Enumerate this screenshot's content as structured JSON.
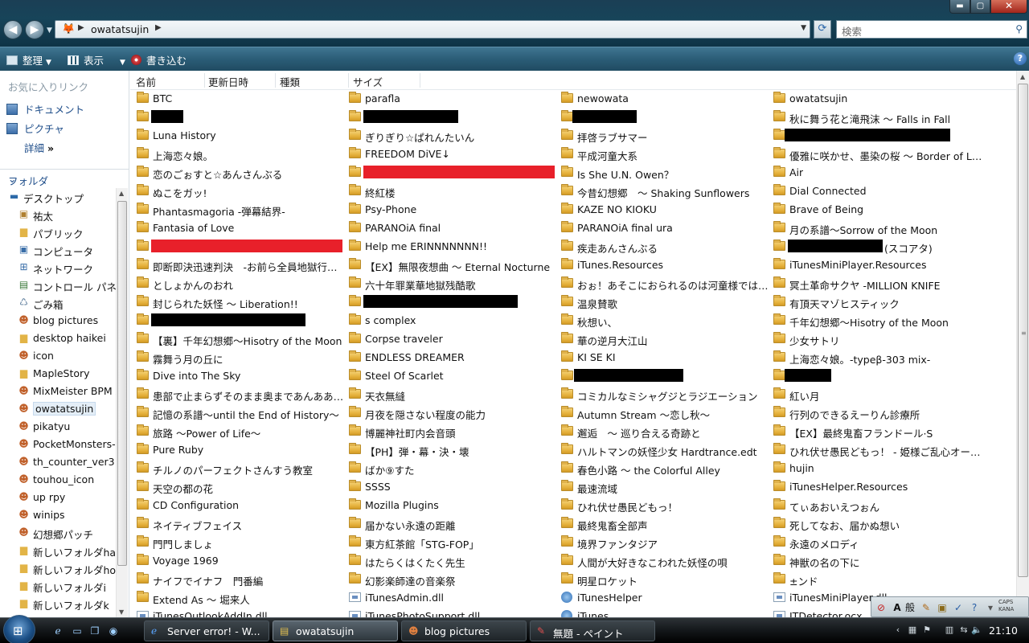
{
  "window": {
    "address": "owatatsujin",
    "search_placeholder": "検索",
    "min_label": "▬",
    "max_label": "▢",
    "close_label": "✕"
  },
  "toolbar": {
    "organize": "整理",
    "views": "表示",
    "burn": "書き込む",
    "help": "?"
  },
  "nav": {
    "favorites_title": "お気に入りリンク",
    "favorites": [
      {
        "label": "ドキュメント"
      },
      {
        "label": "ピクチャ"
      },
      {
        "label": "詳細"
      }
    ],
    "folders_title": "フォルダ",
    "tree": [
      {
        "label": "デスクトップ",
        "icon": "desktop-icon",
        "level": 0
      },
      {
        "label": "祐太",
        "icon": "user-folder-icon",
        "level": 1
      },
      {
        "label": "パブリック",
        "icon": "folder-icon",
        "level": 1
      },
      {
        "label": "コンピュータ",
        "icon": "computer-icon",
        "level": 1
      },
      {
        "label": "ネットワーク",
        "icon": "network-icon",
        "level": 1
      },
      {
        "label": "コントロール パネ",
        "icon": "control-panel-icon",
        "level": 1
      },
      {
        "label": "ごみ箱",
        "icon": "recycle-bin-icon",
        "level": 1
      },
      {
        "label": "blog pictures",
        "icon": "character-folder-icon",
        "level": 1
      },
      {
        "label": "desktop haikei",
        "icon": "folder-icon",
        "level": 1
      },
      {
        "label": "icon",
        "icon": "character-folder-icon",
        "level": 1
      },
      {
        "label": "MapleStory",
        "icon": "folder-icon",
        "level": 1
      },
      {
        "label": "MixMeister BPM A",
        "icon": "character-folder-icon",
        "level": 1
      },
      {
        "label": "owatatsujin",
        "icon": "character-folder-icon",
        "level": 1,
        "selected": true
      },
      {
        "label": "pikatyu",
        "icon": "character-folder-icon",
        "level": 1
      },
      {
        "label": "PocketMonsters-F",
        "icon": "character-folder-icon",
        "level": 1
      },
      {
        "label": "th_counter_ver3",
        "icon": "character-folder-icon",
        "level": 1
      },
      {
        "label": "touhou_icon",
        "icon": "character-folder-icon",
        "level": 1
      },
      {
        "label": "up rpy",
        "icon": "character-folder-icon",
        "level": 1
      },
      {
        "label": "winips",
        "icon": "character-folder-icon",
        "level": 1
      },
      {
        "label": "幻想郷パッチ",
        "icon": "character-folder-icon",
        "level": 1
      },
      {
        "label": "新しいフォルダha",
        "icon": "folder-icon",
        "level": 1
      },
      {
        "label": "新しいフォルダho",
        "icon": "folder-icon",
        "level": 1
      },
      {
        "label": "新しいフォルダi",
        "icon": "folder-icon",
        "level": 1
      },
      {
        "label": "新しいフォルダk",
        "icon": "folder-icon",
        "level": 1
      }
    ]
  },
  "columns": [
    "名前",
    "更新日時",
    "種類",
    "サイズ"
  ],
  "files": {
    "col1": [
      {
        "name": "BTC",
        "type": "folder"
      },
      {
        "name": "",
        "type": "folder",
        "redacted": "black-short"
      },
      {
        "name": "Luna History",
        "type": "folder"
      },
      {
        "name": "上海恋々娘。",
        "type": "folder"
      },
      {
        "name": "恋のごぉすと☆あんさんぶる",
        "type": "folder"
      },
      {
        "name": "ぬこをガッ!",
        "type": "folder"
      },
      {
        "name": "Phantasmagoria -弾幕結界-",
        "type": "folder"
      },
      {
        "name": "Fantasia of Love",
        "type": "folder"
      },
      {
        "name": "",
        "type": "folder",
        "redacted": "red-long"
      },
      {
        "name": "即断即決迅速判決　-お前ら全員地獄行き…",
        "type": "folder"
      },
      {
        "name": "としょかんのおれ",
        "type": "folder"
      },
      {
        "name": "封じられた妖怪 ～ Liberation!!",
        "type": "folder"
      },
      {
        "name": "",
        "type": "folder",
        "redacted": "black-long"
      },
      {
        "name": "【裏】千年幻想郷～Hisotry of the Moon",
        "type": "folder"
      },
      {
        "name": "霧舞う月の丘に",
        "type": "folder"
      },
      {
        "name": "Dive into The Sky",
        "type": "folder"
      },
      {
        "name": "患部で止まらずそのまま奥まであんああ…",
        "type": "folder"
      },
      {
        "name": "記憶の系譜～until the End of History～",
        "type": "folder"
      },
      {
        "name": "旅路 ～Power of Life～",
        "type": "folder"
      },
      {
        "name": "Pure Ruby",
        "type": "folder"
      },
      {
        "name": "チルノのパーフェクトさんすう教室",
        "type": "folder"
      },
      {
        "name": "天空の都の花",
        "type": "folder"
      },
      {
        "name": "CD Configuration",
        "type": "folder"
      },
      {
        "name": "ネイティブフェイス",
        "type": "folder"
      },
      {
        "name": "門門しましょ",
        "type": "folder"
      },
      {
        "name": "Voyage 1969",
        "type": "folder"
      },
      {
        "name": "ナイフでイナフ　門番編",
        "type": "folder"
      },
      {
        "name": "Extend As ～ 堀来人",
        "type": "folder"
      },
      {
        "name": "iTunesOutlookAddIn.dll",
        "type": "dll"
      }
    ],
    "col2": [
      {
        "name": "parafla",
        "type": "folder"
      },
      {
        "name": "",
        "type": "folder",
        "redacted": "black-mid"
      },
      {
        "name": "ぎりぎり☆ぱれんたいん",
        "type": "folder"
      },
      {
        "name": "FREEDOM DiVE↓",
        "type": "folder"
      },
      {
        "name": "",
        "type": "folder",
        "redacted": "red-long"
      },
      {
        "name": "終紅楼",
        "type": "folder"
      },
      {
        "name": "Psy-Phone",
        "type": "folder"
      },
      {
        "name": "PARANOiA final",
        "type": "folder"
      },
      {
        "name": "Help me ERINNNNNNN!!",
        "type": "folder"
      },
      {
        "name": "【EX】無限夜想曲 ～ Eternal Nocturne",
        "type": "folder"
      },
      {
        "name": "六十年罪業華地獄残酷歌",
        "type": "folder"
      },
      {
        "name": "",
        "type": "folder",
        "redacted": "black-long"
      },
      {
        "name": "s complex",
        "type": "folder"
      },
      {
        "name": "Corpse traveler",
        "type": "folder"
      },
      {
        "name": "ENDLESS DREAMER",
        "type": "folder"
      },
      {
        "name": "Steel Of Scarlet",
        "type": "folder"
      },
      {
        "name": "天衣無縫",
        "type": "folder"
      },
      {
        "name": "月夜を隠さない程度の能力",
        "type": "folder"
      },
      {
        "name": "博麗神社町内会音頭",
        "type": "folder"
      },
      {
        "name": "【PH】弾・幕・決・壊",
        "type": "folder"
      },
      {
        "name": "ばか⑨すた",
        "type": "folder"
      },
      {
        "name": "SSSS",
        "type": "folder"
      },
      {
        "name": "Mozilla Plugins",
        "type": "folder"
      },
      {
        "name": "届かない永遠の距離",
        "type": "folder"
      },
      {
        "name": "東方紅茶館「STG-FOP」",
        "type": "folder"
      },
      {
        "name": "はたらくはくたく先生",
        "type": "folder"
      },
      {
        "name": "幻影楽師達の音楽祭",
        "type": "folder"
      },
      {
        "name": "iTunesAdmin.dll",
        "type": "dll"
      },
      {
        "name": "iTunesPhotoSupport.dll",
        "type": "dll"
      }
    ],
    "col3": [
      {
        "name": "newowata",
        "type": "folder"
      },
      {
        "name": "",
        "type": "folder",
        "redacted": "black-short2"
      },
      {
        "name": "拝啓ラブサマー",
        "type": "folder"
      },
      {
        "name": "平成河童大系",
        "type": "folder"
      },
      {
        "name": "Is She U.N. Owen？",
        "type": "folder"
      },
      {
        "name": "今昔幻想郷　～ Shaking Sunflowers",
        "type": "folder"
      },
      {
        "name": "KAZE NO KIOKU",
        "type": "folder"
      },
      {
        "name": "PARANOiA final ura",
        "type": "folder"
      },
      {
        "name": "疾走あんさんぶる",
        "type": "folder"
      },
      {
        "name": "iTunes.Resources",
        "type": "folder"
      },
      {
        "name": "おぉ！あそこにおられるのは河童様では…",
        "type": "folder"
      },
      {
        "name": "温泉賛歌",
        "type": "folder"
      },
      {
        "name": "秋想い、",
        "type": "folder"
      },
      {
        "name": "華の逆月大江山",
        "type": "folder"
      },
      {
        "name": "KI SE KI",
        "type": "folder"
      },
      {
        "name": "",
        "type": "folder",
        "redacted": "black-mid2"
      },
      {
        "name": "コミカルなミシャグジとラジエーション",
        "type": "folder"
      },
      {
        "name": "Autumn Stream ～恋し秋～",
        "type": "folder"
      },
      {
        "name": "邂逅　～ 巡り合える奇跡と",
        "type": "folder"
      },
      {
        "name": "ハルトマンの妖怪少女 Hardtrance.edt",
        "type": "folder"
      },
      {
        "name": "春色小路 ～ the Colorful Alley",
        "type": "folder"
      },
      {
        "name": "最速流域",
        "type": "folder"
      },
      {
        "name": "ひれ伏せ愚民どもっ！",
        "type": "folder"
      },
      {
        "name": "最終鬼畜全部声",
        "type": "folder"
      },
      {
        "name": "境界ファンタジア",
        "type": "folder"
      },
      {
        "name": "人間が大好きなこわれた妖怪の唄",
        "type": "folder"
      },
      {
        "name": "明星ロケット",
        "type": "folder"
      },
      {
        "name": "iTunesHelper",
        "type": "app"
      },
      {
        "name": "iTunes",
        "type": "app"
      }
    ],
    "col4": [
      {
        "name": "owatatsujin",
        "type": "folder"
      },
      {
        "name": "秋に舞う花と滝飛沫 ～ Falls in Fall",
        "type": "folder"
      },
      {
        "name": "",
        "type": "folder",
        "redacted": "black-long2"
      },
      {
        "name": "優雅に咲かせ、墨染の桜 ～ Border of Life",
        "type": "folder"
      },
      {
        "name": "Air",
        "type": "folder"
      },
      {
        "name": "Dial Connected",
        "type": "folder"
      },
      {
        "name": "Brave of Being",
        "type": "folder"
      },
      {
        "name": "月の系譜～Sorrow of the Moon",
        "type": "folder"
      },
      {
        "name": "(スコアタ)",
        "type": "folder",
        "redacted": "black-prefix"
      },
      {
        "name": "iTunesMiniPlayer.Resources",
        "type": "folder"
      },
      {
        "name": "冥土革命サクヤ -MILLION KNIFE",
        "type": "folder"
      },
      {
        "name": "有頂天マゾヒスティック",
        "type": "folder"
      },
      {
        "name": "千年幻想郷～Hisotry of the Moon",
        "type": "folder"
      },
      {
        "name": "少女サトリ",
        "type": "folder"
      },
      {
        "name": "上海恋々娘。-typeβ-303 mix-",
        "type": "folder"
      },
      {
        "name": "",
        "type": "folder",
        "redacted": "black-short3"
      },
      {
        "name": "紅い月",
        "type": "folder"
      },
      {
        "name": "行列のできるえーりん診療所",
        "type": "folder"
      },
      {
        "name": "【EX】最終鬼畜フランドール·S",
        "type": "folder"
      },
      {
        "name": "ひれ伏せ愚民どもっ！ - 姫様ご乱心オー…",
        "type": "folder"
      },
      {
        "name": "hujin",
        "type": "folder"
      },
      {
        "name": "iTunesHelper.Resources",
        "type": "folder"
      },
      {
        "name": "てぃあおいえつぉん",
        "type": "folder"
      },
      {
        "name": "死してなお、届かぬ想い",
        "type": "folder"
      },
      {
        "name": "永遠のメロディ",
        "type": "folder"
      },
      {
        "name": "神獣の名の下に",
        "type": "folder"
      },
      {
        "name": "±ンド",
        "type": "folder"
      },
      {
        "name": "iTunesMiniPlayer.dll",
        "type": "dll"
      },
      {
        "name": "ITDetector.ocx",
        "type": "dll"
      }
    ]
  },
  "taskbar": {
    "tasks": [
      {
        "label": "Server error! - W...",
        "icon": "ie-icon"
      },
      {
        "label": "owatatsujin",
        "icon": "explorer-icon",
        "active": true
      },
      {
        "label": "blog pictures",
        "icon": "character-icon"
      },
      {
        "label": "無題 - ペイント",
        "icon": "paint-icon"
      }
    ],
    "clock": "21:10"
  },
  "langbar": {
    "ime_mode": "A",
    "ime_dict": "般",
    "caps": "CAPS",
    "kana": "KANA"
  },
  "colors": {
    "redact_red": "#e8202a",
    "redact_black": "#000000",
    "link_blue": "#1f4e8a"
  }
}
